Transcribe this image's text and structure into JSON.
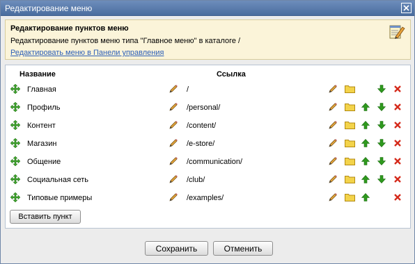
{
  "window": {
    "title": "Редактирование меню"
  },
  "info": {
    "heading": "Редактирование пунктов меню",
    "description": "Редактирование пунктов меню типа \"Главное меню\" в каталоге /",
    "link_label": "Редактировать меню в Панели управления"
  },
  "table": {
    "columns": [
      "Название",
      "Ссылка"
    ],
    "rows": [
      {
        "name": "Главная",
        "link": "/",
        "can_move_up": false,
        "can_move_down": true
      },
      {
        "name": "Профиль",
        "link": "/personal/",
        "can_move_up": true,
        "can_move_down": true
      },
      {
        "name": "Контент",
        "link": "/content/",
        "can_move_up": true,
        "can_move_down": true
      },
      {
        "name": "Магазин",
        "link": "/e-store/",
        "can_move_up": true,
        "can_move_down": true
      },
      {
        "name": "Общение",
        "link": "/communication/",
        "can_move_up": true,
        "can_move_down": true
      },
      {
        "name": "Социальная сеть",
        "link": "/club/",
        "can_move_up": true,
        "can_move_down": true
      },
      {
        "name": "Типовые примеры",
        "link": "/examples/",
        "can_move_up": true,
        "can_move_down": false
      }
    ],
    "row_icons": [
      "move-icon",
      "pencil-icon",
      "pencil-icon",
      "folder-icon",
      "arrow-up-icon",
      "arrow-down-icon",
      "delete-icon"
    ]
  },
  "buttons": {
    "insert": "Вставить пункт",
    "save": "Сохранить",
    "cancel": "Отменить"
  },
  "colors": {
    "titlebar": "#5a7bac",
    "info_bg": "#fbf4d9",
    "link": "#2c5fb8",
    "arrow_green": "#2f9a1e",
    "delete_red": "#d52a1b",
    "folder_yellow": "#f3d34a"
  }
}
